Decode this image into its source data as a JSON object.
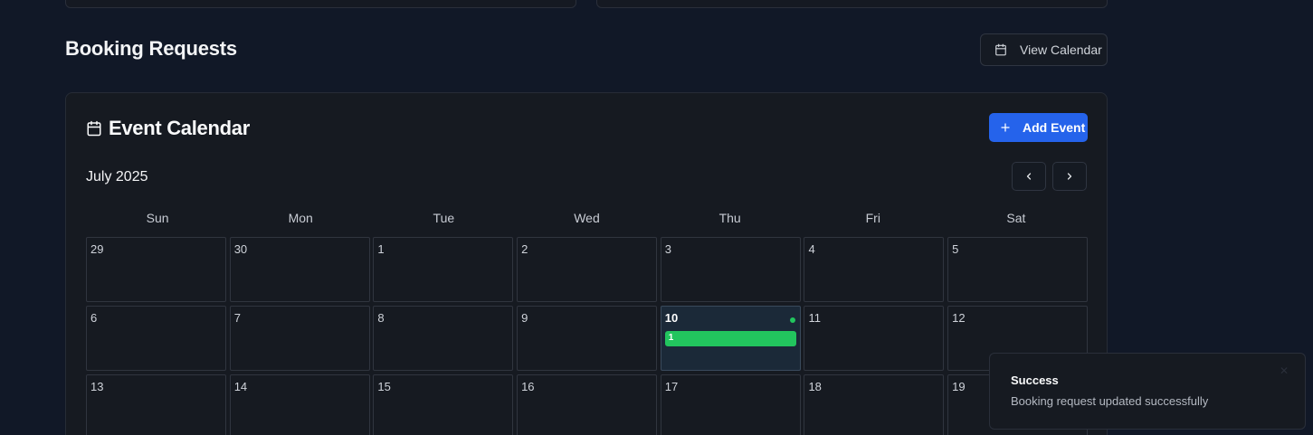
{
  "section": {
    "title": "Booking Requests",
    "view_calendar_label": "View Calendar"
  },
  "calendar": {
    "title": "Event Calendar",
    "add_event_label": "Add Event",
    "month_label": "July 2025",
    "days_of_week": [
      "Sun",
      "Mon",
      "Tue",
      "Wed",
      "Thu",
      "Fri",
      "Sat"
    ],
    "weeks": [
      [
        "29",
        "30",
        "1",
        "2",
        "3",
        "4",
        "5"
      ],
      [
        "6",
        "7",
        "8",
        "9",
        "10",
        "11",
        "12"
      ],
      [
        "13",
        "14",
        "15",
        "16",
        "17",
        "18",
        "19"
      ]
    ],
    "today": "10",
    "events": [
      {
        "day": "10",
        "label": "1",
        "color": "#22c55e"
      }
    ]
  },
  "toast": {
    "title": "Success",
    "description": "Booking request updated successfully",
    "close_icon": "close-icon"
  },
  "colors": {
    "background": "#111827",
    "accent": "#2563eb",
    "success": "#22c55e"
  }
}
